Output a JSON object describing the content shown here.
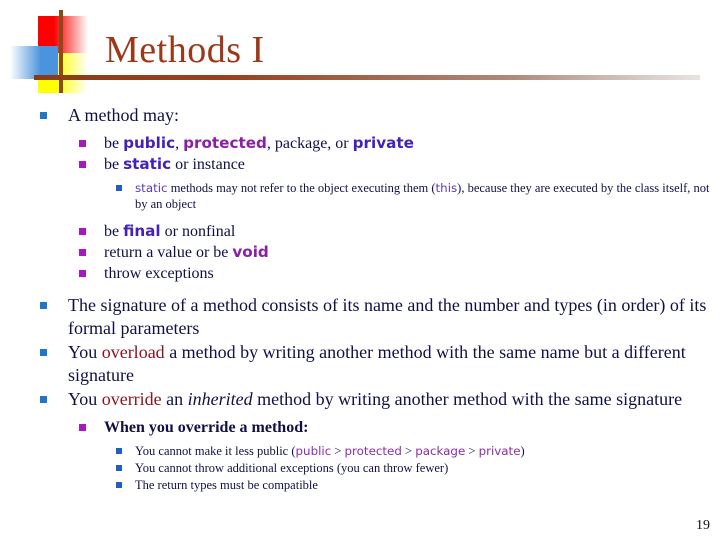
{
  "slide": {
    "title": "Methods I",
    "page_number": "19",
    "title_color": "#9C3817",
    "body_text_color": "#101046",
    "keyword_color": "#4421B8",
    "emphasis_color": "#8C1320",
    "bullet_level1_color": "#1F76C8",
    "bullet_level2_color": "#A619BD",
    "bullet_level3_color": "#1F5FC0"
  },
  "logo": {
    "red_square": "#FD0000",
    "yellow_square": "#FFFF00",
    "blue_square": "#4A94DD",
    "rule_color": "#8A4A1C"
  },
  "bullets": {
    "b1": "A method may:",
    "b1_1_pre": "be ",
    "b1_1_kw1": "public",
    "b1_1_mid1": ", ",
    "b1_1_kw2": "protected",
    "b1_1_mid2": ", package, or ",
    "b1_1_kw3": "private",
    "b1_2_pre": "be ",
    "b1_2_kw": "static",
    "b1_2_post": " or instance",
    "b1_2_1_kw": "static",
    "b1_2_1_mid": " methods may not refer to the object executing them (",
    "b1_2_1_kw2": "this",
    "b1_2_1_post": "), because they are executed by the class itself, not by an object",
    "b1_3_pre": "be ",
    "b1_3_kw": "final",
    "b1_3_post": " or nonfinal",
    "b1_4_pre": "return a value or be ",
    "b1_4_kw": "void",
    "b1_5": "throw exceptions",
    "b2": "The signature of a method consists of its name and the number and types (in order) of its formal parameters",
    "b3_pre": "You ",
    "b3_em": "overload",
    "b3_post": " a method by writing another method with the same name but a different signature",
    "b4_pre": "You ",
    "b4_em": "override",
    "b4_mid": " an ",
    "b4_ital": "inherited",
    "b4_post": " method by writing another method with the same signature",
    "b4_1": "When you override a method:",
    "b4_1_1_pre": "You cannot make it less public (",
    "b4_1_1_kw1": "public",
    "b4_1_1_sep1": " > ",
    "b4_1_1_kw2": "protected",
    "b4_1_1_sep2": " > ",
    "b4_1_1_kw3": "package",
    "b4_1_1_sep3": " > ",
    "b4_1_1_kw4": "private",
    "b4_1_1_post": ")",
    "b4_1_2": "You cannot throw additional exceptions (you can throw fewer)",
    "b4_1_3": "The return types must be compatible"
  }
}
